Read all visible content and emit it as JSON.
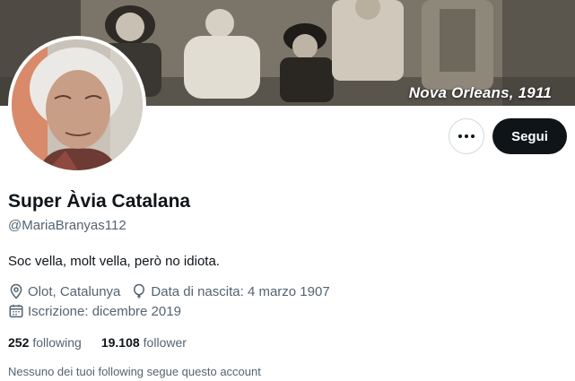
{
  "banner": {
    "caption": "Nova Orleans, 1911"
  },
  "profile": {
    "display_name": "Super Àvia Catalana",
    "handle": "@MariaBranyas112",
    "bio": "Soc vella, molt vella, però no idiota.",
    "location": "Olot, Catalunya",
    "birthdate": "Data di nascita: 4 marzo 1907",
    "joined": "Iscrizione: dicembre 2019"
  },
  "actions": {
    "follow_label": "Segui",
    "more_icon": "more-horizontal-icon"
  },
  "stats": {
    "following_count": "252",
    "following_label": "following",
    "followers_count": "19.108",
    "followers_label": "follower"
  },
  "follow_note": "Nessuno dei tuoi following segue questo account",
  "colors": {
    "primary_text": "#0f1419",
    "secondary_text": "#536471",
    "button_dark": "#0f1419",
    "border": "#cfd9de"
  }
}
